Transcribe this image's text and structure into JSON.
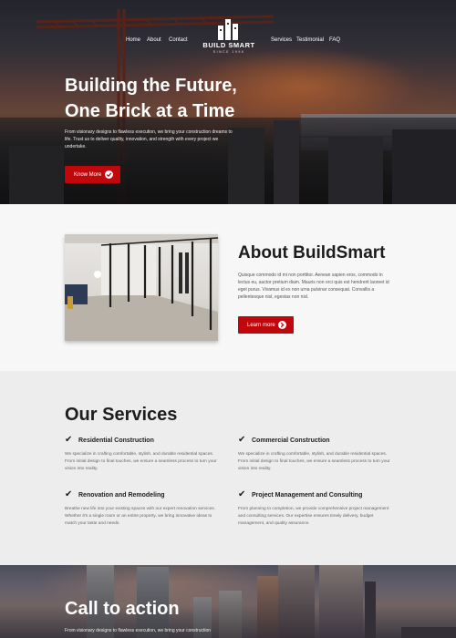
{
  "nav": {
    "left_links": [
      "Home",
      "About",
      "Contact"
    ],
    "right_links": [
      "Services",
      "Testimonial",
      "FAQ"
    ]
  },
  "logo": {
    "name": "BUILD SMART",
    "since": "SINCE 1996"
  },
  "hero": {
    "title_line1": "Building the Future,",
    "title_line2": "One Brick at a Time",
    "text": "From visionary designs to flawless execution, we bring your construction dreams to life. Trust us to deliver quality, innovation, and strength with every project we undertake.",
    "button_label": "Know More"
  },
  "about": {
    "title": "About BuildSmart",
    "text": "Quisque commodo id mi non porttitor. Aenean sapien eros, commodo in lectus eu, auctor pretium diam. Mauris non orci quis est hendrerit laoreet id eget purus. Vivamus id ex non urna pulvinar consequat. Convallis a pellentesque nisl, egestas non nisl.",
    "button_label": "Learn more"
  },
  "services": {
    "title": "Our Services",
    "items": [
      {
        "title": "Residential Construction",
        "text": "We specialize in crafting comfortable, stylish, and durable residential spaces. From initial design to final touches, we ensure a seamless process to turn your vision into reality."
      },
      {
        "title": "Commercial Construction",
        "text": "We specialize in crafting comfortable, stylish, and durable residential spaces. From initial design to final touches, we ensure a seamless process to turn your vision into reality."
      },
      {
        "title": "Renovation and Remodeling",
        "text": "Breathe new life into your existing spaces with our expert renovation services. Whether it's a single room or an entire property, we bring innovative ideas to match your taste and needs."
      },
      {
        "title": "Project Management and Consulting",
        "text": "From planning to completion, we provide comprehensive project management and consulting services. Our expertise ensures timely delivery, budget management, and quality assurance."
      }
    ]
  },
  "cta": {
    "title": "Call to action",
    "text": "From visionary designs to flawless execution, we bring your construction"
  },
  "icons": {
    "check": "check-icon",
    "arrow": "arrow-circle-icon"
  },
  "colors": {
    "accent": "#c0070b"
  }
}
